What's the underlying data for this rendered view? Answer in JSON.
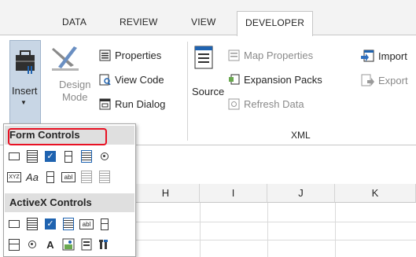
{
  "tabs": [
    {
      "label": "DATA",
      "active": false
    },
    {
      "label": "REVIEW",
      "active": false
    },
    {
      "label": "VIEW",
      "active": false
    },
    {
      "label": "DEVELOPER",
      "active": true
    }
  ],
  "ribbon": {
    "code": {
      "insert_label": "Insert",
      "design_label": "Design",
      "mode_label": "Mode",
      "properties_label": "Properties",
      "view_code_label": "View Code",
      "run_dialog_label": "Run Dialog"
    },
    "xml": {
      "group_label": "XML",
      "source_label": "Source",
      "map_properties_label": "Map Properties",
      "expansion_packs_label": "Expansion Packs",
      "refresh_data_label": "Refresh Data",
      "import_label": "Import",
      "export_label": "Export"
    }
  },
  "insert_dropdown": {
    "form_controls_header": "Form Controls",
    "activex_controls_header": "ActiveX Controls",
    "form_controls_row1": [
      "combo-box-icon",
      "list-box-icon",
      "checkbox-icon",
      "spin-button-icon",
      "list-box-icon",
      "option-button-icon"
    ],
    "form_controls_row2": [
      "group-box-icon",
      "label-icon",
      "scroll-bar-icon",
      "text-field-icon",
      "combo-list-icon",
      "combo-drop-icon"
    ],
    "activex_controls_row1": [
      "command-button-icon",
      "combo-box-icon",
      "checkbox-icon",
      "list-box-icon",
      "text-box-icon",
      "scroll-bar-icon"
    ],
    "activex_controls_row2": [
      "spin-button-icon",
      "option-button-icon",
      "label-icon",
      "image-icon",
      "toggle-button-icon",
      "more-controls-icon"
    ],
    "row2_form_text": [
      "XYZ",
      "Aa",
      "abl"
    ],
    "activex_text": [
      "abl",
      "A"
    ]
  },
  "sheet": {
    "columns": [
      "H",
      "I",
      "J",
      "K"
    ]
  },
  "colors": {
    "accent": "#1f63b0",
    "highlight_border": "#e81123",
    "insert_selected_bg": "#c8d6e5"
  }
}
